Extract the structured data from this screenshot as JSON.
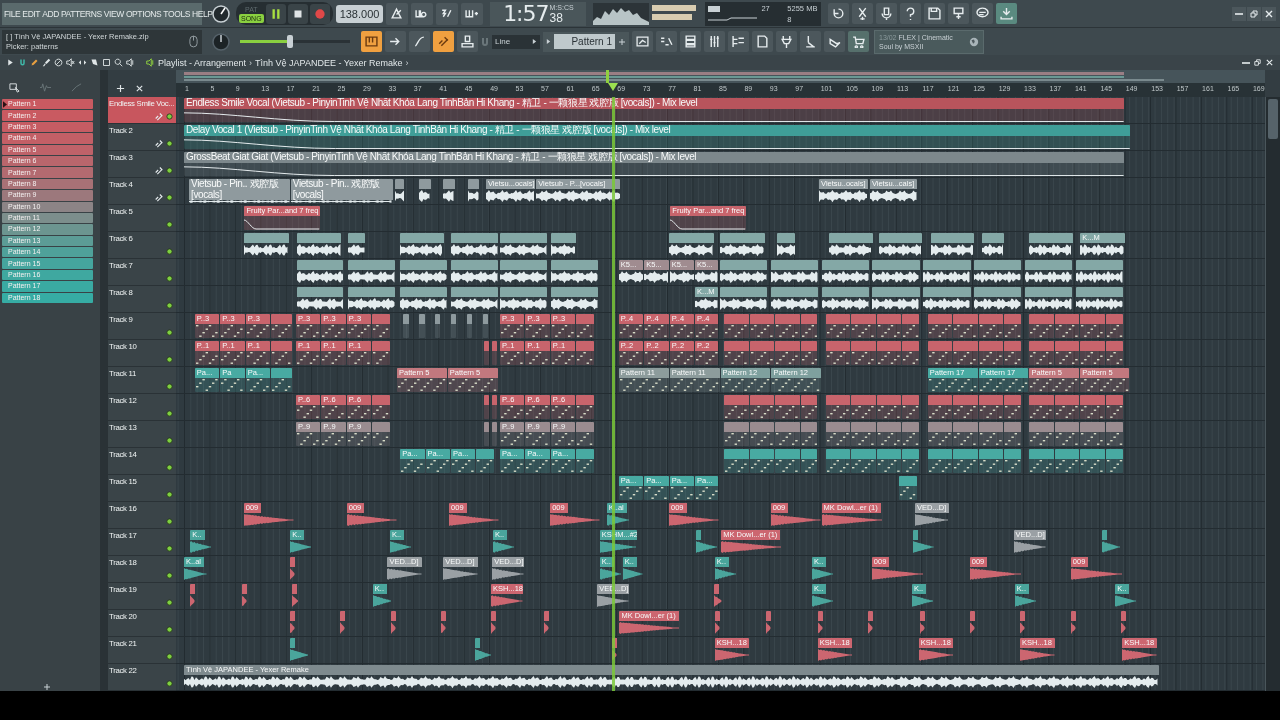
{
  "menu": [
    "FILE",
    "EDIT",
    "ADD",
    "PATTERNS",
    "VIEW",
    "OPTIONS",
    "TOOLS",
    "HELP"
  ],
  "mode": [
    {
      "label": "PAT",
      "selected": false
    },
    {
      "label": "SONG",
      "selected": true
    }
  ],
  "tempo": "138.000",
  "time": {
    "value": "1:57",
    "cs": "38",
    "unit": "M:S:CS"
  },
  "memory": {
    "cpu": "27",
    "ram": "5255 MB",
    "polyphony": "8"
  },
  "hint": {
    "line1": "[    ]  Tình Vệ JAPANDEE - Yexer Remake.zip",
    "line2": "Picker: patterns"
  },
  "master": {
    "level": 0.45
  },
  "snap": "Line",
  "pattern_selector": "Pattern 1",
  "news": {
    "date": "13/02",
    "title": "FLEX | Cinematic",
    "subtitle": "Soul by MSXII"
  },
  "playlist": {
    "title": "Playlist - Arrangement",
    "sep1": "›",
    "song": "Tình Vệ JAPANDEE - Yexer Remake",
    "sep2": "›"
  },
  "ruler": [
    "1",
    "5",
    "9",
    "13",
    "17",
    "21",
    "25",
    "29",
    "33",
    "37",
    "41",
    "45",
    "49",
    "53",
    "57",
    "61",
    "65",
    "69",
    "73",
    "77",
    "81",
    "85",
    "89",
    "93",
    "97",
    "101",
    "105",
    "109",
    "113",
    "117",
    "121",
    "125",
    "129",
    "133",
    "137",
    "141",
    "145",
    "149",
    "153",
    "157",
    "161",
    "165",
    "169"
  ],
  "patterns": [
    {
      "name": "Pattern 1",
      "color": "#c95a61",
      "selected": true
    },
    {
      "name": "Pattern 2",
      "color": "#c95a61",
      "selected": false
    },
    {
      "name": "Pattern 3",
      "color": "#c65c63",
      "selected": false
    },
    {
      "name": "Pattern 4",
      "color": "#c35f66",
      "selected": false
    },
    {
      "name": "Pattern 5",
      "color": "#bf6269",
      "selected": false
    },
    {
      "name": "Pattern 6",
      "color": "#b9666c",
      "selected": false
    },
    {
      "name": "Pattern 7",
      "color": "#b36a70",
      "selected": false
    },
    {
      "name": "Pattern 8",
      "color": "#a87176",
      "selected": false
    },
    {
      "name": "Pattern 9",
      "color": "#9c787c",
      "selected": false
    },
    {
      "name": "Pattern 10",
      "color": "#8c8486",
      "selected": false
    },
    {
      "name": "Pattern 11",
      "color": "#7c8e8c",
      "selected": false
    },
    {
      "name": "Pattern 12",
      "color": "#6c9590",
      "selected": false
    },
    {
      "name": "Pattern 13",
      "color": "#5c9c96",
      "selected": false
    },
    {
      "name": "Pattern 14",
      "color": "#4fa19a",
      "selected": false
    },
    {
      "name": "Pattern 15",
      "color": "#45a59e",
      "selected": false
    },
    {
      "name": "Pattern 16",
      "color": "#3fa8a0",
      "selected": false
    },
    {
      "name": "Pattern 17",
      "color": "#3aaaa2",
      "selected": false
    },
    {
      "name": "Pattern 18",
      "color": "#36aca4",
      "selected": false
    }
  ],
  "tracks": [
    {
      "name": "Endless Smile Voc...",
      "selected": true,
      "linked": true,
      "clips": [
        {
          "label": "Endless Smile Vocal (Vietsub - PinyinTinh Vệ  Nhất Khỏa Lang TinhBản Hi Khang - 精卫 - 一颗狼星 戏腔版 [vocals]) - Mix level",
          "kind": "automation",
          "color": "#b8545c"
        }
      ]
    },
    {
      "name": "Track 2",
      "selected": false,
      "linked": true,
      "clips": [
        {
          "label": "Delay Vocal 1 (Vietsub - PinyinTinh Vệ  Nhất Khỏa Lang TinhBản Hi Khang - 精卫 - 一颗狼星 戏腔版 [vocals]) - Mix level",
          "kind": "automation",
          "color": "#3f9e98"
        }
      ]
    },
    {
      "name": "Track 3",
      "selected": false,
      "linked": true,
      "clips": [
        {
          "label": "GrossBeat Giat Giat (Vietsub - PinyinTinh Vệ  Nhất Khỏa Lang TinhBản Hi Khang - 精卫 - 一颗狼星 戏腔版 [vocals]) - Mix level",
          "kind": "automation",
          "color": "#7d888c"
        }
      ]
    },
    {
      "name": "Track 4",
      "selected": false,
      "linked": true,
      "clips": [
        {
          "label": "Vietsub - Pin.. 戏腔版 [vocals]",
          "kind": "audio",
          "color": "#8f9a9e"
        },
        {
          "label": "Vietsub - Pin.. 戏腔版 [vocals]",
          "kind": "audio",
          "color": "#8f9a9e"
        },
        {
          "kind": "audio",
          "color": "#8f9a9e"
        },
        {
          "kind": "audio",
          "color": "#8f9a9e"
        },
        {
          "kind": "audio",
          "color": "#8f9a9e"
        },
        {
          "kind": "audio",
          "color": "#8f9a9e"
        },
        {
          "label": "Vietsu...ocals]",
          "kind": "audio",
          "color": "#8f9a9e"
        },
        {
          "label": "Vietsub - P...[vocals]",
          "kind": "audio",
          "color": "#8f9a9e"
        },
        {
          "label": "Vietsu..ocals]",
          "kind": "audio",
          "color": "#8f9a9e"
        },
        {
          "label": "Vietsu...cals]",
          "kind": "audio",
          "color": "#8f9a9e"
        }
      ]
    },
    {
      "name": "Track 5",
      "selected": false,
      "linked": false,
      "clips": [
        {
          "label": "Fruity Par...and 7 freq",
          "kind": "automation",
          "color": "#c8646c"
        },
        {
          "label": "Fruity Par...and 7 freq",
          "kind": "automation",
          "color": "#c8646c"
        }
      ]
    },
    {
      "name": "Track 6",
      "selected": false,
      "linked": false,
      "clips": [
        {
          "kind": "audio",
          "color": "#84a8a6"
        },
        {
          "kind": "audio",
          "color": "#84a8a6"
        },
        {
          "kind": "audio",
          "color": "#84a8a6"
        },
        {
          "kind": "audio",
          "color": "#84a8a6"
        },
        {
          "kind": "audio",
          "color": "#84a8a6"
        },
        {
          "kind": "audio",
          "color": "#84a8a6"
        },
        {
          "kind": "audio",
          "color": "#84a8a6"
        },
        {
          "kind": "audio",
          "color": "#84a8a6"
        },
        {
          "kind": "audio",
          "color": "#84a8a6"
        },
        {
          "kind": "audio",
          "color": "#84a8a6"
        },
        {
          "kind": "audio",
          "color": "#84a8a6"
        },
        {
          "kind": "audio",
          "color": "#84a8a6"
        },
        {
          "kind": "audio",
          "color": "#84a8a6"
        },
        {
          "kind": "audio",
          "color": "#84a8a6"
        },
        {
          "kind": "audio",
          "color": "#84a8a6"
        },
        {
          "label": "K...M",
          "kind": "audio",
          "color": "#84a8a6"
        }
      ]
    },
    {
      "name": "Track 7",
      "selected": false,
      "linked": false,
      "clips": [
        {
          "kind": "audio",
          "color": "#84a8a6"
        },
        {
          "kind": "audio",
          "color": "#84a8a6"
        },
        {
          "kind": "audio",
          "color": "#84a8a6"
        },
        {
          "kind": "audio",
          "color": "#84a8a6"
        },
        {
          "kind": "audio",
          "color": "#84a8a6"
        },
        {
          "kind": "audio",
          "color": "#84a8a6"
        },
        {
          "label": "K5...",
          "kind": "audio",
          "color": "#a08c90"
        },
        {
          "label": "K5...",
          "kind": "audio",
          "color": "#a08c90"
        },
        {
          "label": "K5...",
          "kind": "audio",
          "color": "#a08c90"
        },
        {
          "label": "K5...",
          "kind": "audio",
          "color": "#a08c90"
        },
        {
          "kind": "audio",
          "color": "#84a8a6"
        },
        {
          "kind": "audio",
          "color": "#84a8a6"
        },
        {
          "kind": "audio",
          "color": "#84a8a6"
        },
        {
          "kind": "audio",
          "color": "#84a8a6"
        },
        {
          "kind": "audio",
          "color": "#84a8a6"
        },
        {
          "kind": "audio",
          "color": "#84a8a6"
        },
        {
          "kind": "audio",
          "color": "#84a8a6"
        },
        {
          "kind": "audio",
          "color": "#84a8a6"
        }
      ]
    },
    {
      "name": "Track 8",
      "selected": false,
      "linked": false,
      "clips": [
        {
          "kind": "audio",
          "color": "#84a8a6"
        },
        {
          "kind": "audio",
          "color": "#84a8a6"
        },
        {
          "kind": "audio",
          "color": "#84a8a6"
        },
        {
          "kind": "audio",
          "color": "#84a8a6"
        },
        {
          "kind": "audio",
          "color": "#84a8a6"
        },
        {
          "kind": "audio",
          "color": "#84a8a6"
        },
        {
          "label": "K...M",
          "kind": "audio",
          "color": "#84a8a6"
        },
        {
          "kind": "audio",
          "color": "#84a8a6"
        },
        {
          "kind": "audio",
          "color": "#84a8a6"
        },
        {
          "kind": "audio",
          "color": "#84a8a6"
        },
        {
          "kind": "audio",
          "color": "#84a8a6"
        },
        {
          "kind": "audio",
          "color": "#84a8a6"
        },
        {
          "kind": "audio",
          "color": "#84a8a6"
        },
        {
          "kind": "audio",
          "color": "#84a8a6"
        },
        {
          "kind": "audio",
          "color": "#84a8a6"
        }
      ]
    },
    {
      "name": "Track 9",
      "selected": false,
      "linked": false,
      "clips": [
        {
          "label": "P..3",
          "kind": "pattern",
          "color": "#c8646c"
        },
        {
          "label": "P..3",
          "kind": "pattern",
          "color": "#c8646c"
        },
        {
          "label": "P..3",
          "kind": "pattern",
          "color": "#c8646c"
        },
        {
          "kind": "pattern",
          "color": "#c8646c"
        },
        {
          "label": "P..3",
          "kind": "pattern",
          "color": "#c8646c"
        },
        {
          "label": "P..3",
          "kind": "pattern",
          "color": "#c8646c"
        },
        {
          "label": "P..3",
          "kind": "pattern",
          "color": "#c8646c"
        },
        {
          "kind": "pattern",
          "color": "#c8646c"
        },
        {
          "kind": "pattern",
          "color": "#8e9a9e"
        },
        {
          "kind": "pattern",
          "color": "#8e9a9e"
        },
        {
          "kind": "pattern",
          "color": "#8e9a9e"
        },
        {
          "kind": "pattern",
          "color": "#8e9a9e"
        },
        {
          "kind": "pattern",
          "color": "#8e9a9e"
        },
        {
          "kind": "pattern",
          "color": "#8e9a9e"
        },
        {
          "label": "P..3",
          "kind": "pattern",
          "color": "#c8646c"
        },
        {
          "label": "P..3",
          "kind": "pattern",
          "color": "#c8646c"
        },
        {
          "label": "P..3",
          "kind": "pattern",
          "color": "#c8646c"
        },
        {
          "kind": "pattern",
          "color": "#c8646c"
        },
        {
          "label": "P..4",
          "kind": "pattern",
          "color": "#c8646c"
        },
        {
          "label": "P..4",
          "kind": "pattern",
          "color": "#c8646c"
        },
        {
          "label": "P..4",
          "kind": "pattern",
          "color": "#c8646c"
        },
        {
          "label": "P..4",
          "kind": "pattern",
          "color": "#c8646c"
        },
        {
          "kind": "pattern",
          "color": "#c8646c"
        },
        {
          "kind": "pattern",
          "color": "#c8646c"
        },
        {
          "kind": "pattern",
          "color": "#c8646c"
        },
        {
          "kind": "pattern",
          "color": "#c8646c"
        },
        {
          "kind": "pattern",
          "color": "#c8646c"
        },
        {
          "kind": "pattern",
          "color": "#c8646c"
        },
        {
          "kind": "pattern",
          "color": "#c8646c"
        },
        {
          "kind": "pattern",
          "color": "#c8646c"
        },
        {
          "kind": "pattern",
          "color": "#c8646c"
        },
        {
          "kind": "pattern",
          "color": "#c8646c"
        },
        {
          "kind": "pattern",
          "color": "#c8646c"
        },
        {
          "kind": "pattern",
          "color": "#c8646c"
        },
        {
          "kind": "pattern",
          "color": "#c8646c"
        },
        {
          "kind": "pattern",
          "color": "#c8646c"
        },
        {
          "kind": "pattern",
          "color": "#c8646c"
        },
        {
          "kind": "pattern",
          "color": "#c8646c"
        }
      ]
    },
    {
      "name": "Track 10",
      "selected": false,
      "linked": false,
      "clips": [
        {
          "label": "P..1",
          "kind": "pattern",
          "color": "#c8646c"
        },
        {
          "label": "P..1",
          "kind": "pattern",
          "color": "#c8646c"
        },
        {
          "label": "P..1",
          "kind": "pattern",
          "color": "#c8646c"
        },
        {
          "kind": "pattern",
          "color": "#c8646c"
        },
        {
          "label": "P..1",
          "kind": "pattern",
          "color": "#c8646c"
        },
        {
          "label": "P..1",
          "kind": "pattern",
          "color": "#c8646c"
        },
        {
          "label": "P..1",
          "kind": "pattern",
          "color": "#c8646c"
        },
        {
          "kind": "pattern",
          "color": "#c8646c"
        },
        {
          "kind": "pattern",
          "color": "#c8646c"
        },
        {
          "kind": "pattern",
          "color": "#c8646c"
        },
        {
          "label": "P..1",
          "kind": "pattern",
          "color": "#c8646c"
        },
        {
          "label": "P..1",
          "kind": "pattern",
          "color": "#c8646c"
        },
        {
          "label": "P..1",
          "kind": "pattern",
          "color": "#c8646c"
        },
        {
          "kind": "pattern",
          "color": "#c8646c"
        },
        {
          "label": "P..2",
          "kind": "pattern",
          "color": "#c8646c"
        },
        {
          "label": "P..2",
          "kind": "pattern",
          "color": "#c8646c"
        },
        {
          "label": "P..2",
          "kind": "pattern",
          "color": "#c8646c"
        },
        {
          "label": "P..2",
          "kind": "pattern",
          "color": "#c8646c"
        },
        {
          "kind": "pattern",
          "color": "#c8646c"
        },
        {
          "kind": "pattern",
          "color": "#c8646c"
        },
        {
          "kind": "pattern",
          "color": "#c8646c"
        },
        {
          "kind": "pattern",
          "color": "#c8646c"
        },
        {
          "kind": "pattern",
          "color": "#c8646c"
        },
        {
          "kind": "pattern",
          "color": "#c8646c"
        },
        {
          "kind": "pattern",
          "color": "#c8646c"
        },
        {
          "kind": "pattern",
          "color": "#c8646c"
        },
        {
          "kind": "pattern",
          "color": "#c8646c"
        },
        {
          "kind": "pattern",
          "color": "#c8646c"
        },
        {
          "kind": "pattern",
          "color": "#c8646c"
        },
        {
          "kind": "pattern",
          "color": "#c8646c"
        },
        {
          "kind": "pattern",
          "color": "#c8646c"
        },
        {
          "kind": "pattern",
          "color": "#c8646c"
        },
        {
          "kind": "pattern",
          "color": "#c8646c"
        },
        {
          "kind": "pattern",
          "color": "#c8646c"
        }
      ]
    },
    {
      "name": "Track 11",
      "selected": false,
      "linked": false,
      "clips": [
        {
          "label": "Pa...",
          "kind": "pattern",
          "color": "#48aaa2"
        },
        {
          "label": "Pa",
          "kind": "pattern",
          "color": "#48aaa2"
        },
        {
          "label": "Pa...",
          "kind": "pattern",
          "color": "#48aaa2"
        },
        {
          "kind": "pattern",
          "color": "#48aaa2"
        },
        {
          "label": "Pattern 5",
          "kind": "pattern",
          "color": "#c2787e"
        },
        {
          "label": "Pattern 5",
          "kind": "pattern",
          "color": "#c2787e"
        },
        {
          "label": "Pattern 11",
          "kind": "pattern",
          "color": "#8d9c9c"
        },
        {
          "label": "Pattern 11",
          "kind": "pattern",
          "color": "#8d9c9c"
        },
        {
          "label": "Pattern 12",
          "kind": "pattern",
          "color": "#7fa09e"
        },
        {
          "label": "Pattern 12",
          "kind": "pattern",
          "color": "#7fa09e"
        },
        {
          "label": "Pattern 17",
          "kind": "pattern",
          "color": "#48aaa2"
        },
        {
          "label": "Pattern 17",
          "kind": "pattern",
          "color": "#48aaa2"
        },
        {
          "label": "Pattern 5",
          "kind": "pattern",
          "color": "#c2787e"
        },
        {
          "label": "Pattern 5",
          "kind": "pattern",
          "color": "#c2787e"
        }
      ]
    },
    {
      "name": "Track 12",
      "selected": false,
      "linked": false,
      "clips": [
        {
          "label": "P..6",
          "kind": "pattern",
          "color": "#c8646c"
        },
        {
          "label": "P..6",
          "kind": "pattern",
          "color": "#c8646c"
        },
        {
          "label": "P..6",
          "kind": "pattern",
          "color": "#c8646c"
        },
        {
          "kind": "pattern",
          "color": "#c8646c"
        },
        {
          "kind": "pattern",
          "color": "#c8646c"
        },
        {
          "kind": "pattern",
          "color": "#c8646c"
        },
        {
          "label": "P..6",
          "kind": "pattern",
          "color": "#c8646c"
        },
        {
          "label": "P..6",
          "kind": "pattern",
          "color": "#c8646c"
        },
        {
          "label": "P..6",
          "kind": "pattern",
          "color": "#c8646c"
        },
        {
          "kind": "pattern",
          "color": "#c8646c"
        },
        {
          "kind": "pattern",
          "color": "#c8646c"
        },
        {
          "kind": "pattern",
          "color": "#c8646c"
        },
        {
          "kind": "pattern",
          "color": "#c8646c"
        },
        {
          "kind": "pattern",
          "color": "#c8646c"
        },
        {
          "kind": "pattern",
          "color": "#c8646c"
        },
        {
          "kind": "pattern",
          "color": "#c8646c"
        },
        {
          "kind": "pattern",
          "color": "#c8646c"
        },
        {
          "kind": "pattern",
          "color": "#c8646c"
        },
        {
          "kind": "pattern",
          "color": "#c8646c"
        },
        {
          "kind": "pattern",
          "color": "#c8646c"
        },
        {
          "kind": "pattern",
          "color": "#c8646c"
        },
        {
          "kind": "pattern",
          "color": "#c8646c"
        },
        {
          "kind": "pattern",
          "color": "#c8646c"
        },
        {
          "kind": "pattern",
          "color": "#c8646c"
        },
        {
          "kind": "pattern",
          "color": "#c8646c"
        },
        {
          "kind": "pattern",
          "color": "#c8646c"
        }
      ]
    },
    {
      "name": "Track 13",
      "selected": false,
      "linked": false,
      "clips": [
        {
          "label": "P..9",
          "kind": "pattern",
          "color": "#9a8c90"
        },
        {
          "label": "P..9",
          "kind": "pattern",
          "color": "#9a8c90"
        },
        {
          "label": "P..9",
          "kind": "pattern",
          "color": "#9a8c90"
        },
        {
          "kind": "pattern",
          "color": "#9a8c90"
        },
        {
          "kind": "pattern",
          "color": "#9a8c90"
        },
        {
          "kind": "pattern",
          "color": "#9a8c90"
        },
        {
          "label": "P..9",
          "kind": "pattern",
          "color": "#9a8c90"
        },
        {
          "label": "P..9",
          "kind": "pattern",
          "color": "#9a8c90"
        },
        {
          "label": "P..9",
          "kind": "pattern",
          "color": "#9a8c90"
        },
        {
          "kind": "pattern",
          "color": "#9a8c90"
        },
        {
          "kind": "pattern",
          "color": "#9a8c90"
        },
        {
          "kind": "pattern",
          "color": "#9a8c90"
        },
        {
          "kind": "pattern",
          "color": "#9a8c90"
        },
        {
          "kind": "pattern",
          "color": "#9a8c90"
        },
        {
          "kind": "pattern",
          "color": "#9a8c90"
        },
        {
          "kind": "pattern",
          "color": "#9a8c90"
        },
        {
          "kind": "pattern",
          "color": "#9a8c90"
        },
        {
          "kind": "pattern",
          "color": "#9a8c90"
        },
        {
          "kind": "pattern",
          "color": "#9a8c90"
        },
        {
          "kind": "pattern",
          "color": "#9a8c90"
        },
        {
          "kind": "pattern",
          "color": "#9a8c90"
        },
        {
          "kind": "pattern",
          "color": "#9a8c90"
        },
        {
          "kind": "pattern",
          "color": "#9a8c90"
        },
        {
          "kind": "pattern",
          "color": "#9a8c90"
        },
        {
          "kind": "pattern",
          "color": "#9a8c90"
        },
        {
          "kind": "pattern",
          "color": "#9a8c90"
        }
      ]
    },
    {
      "name": "Track 14",
      "selected": false,
      "linked": false,
      "clips": [
        {
          "label": "Pa...",
          "kind": "pattern",
          "color": "#48aaa2"
        },
        {
          "label": "Pa...",
          "kind": "pattern",
          "color": "#48aaa2"
        },
        {
          "label": "Pa...",
          "kind": "pattern",
          "color": "#48aaa2"
        },
        {
          "kind": "pattern",
          "color": "#48aaa2"
        },
        {
          "label": "Pa...",
          "kind": "pattern",
          "color": "#48aaa2"
        },
        {
          "label": "Pa...",
          "kind": "pattern",
          "color": "#48aaa2"
        },
        {
          "label": "Pa...",
          "kind": "pattern",
          "color": "#48aaa2"
        },
        {
          "kind": "pattern",
          "color": "#48aaa2"
        },
        {
          "kind": "pattern",
          "color": "#48aaa2"
        },
        {
          "kind": "pattern",
          "color": "#48aaa2"
        },
        {
          "kind": "pattern",
          "color": "#48aaa2"
        },
        {
          "kind": "pattern",
          "color": "#48aaa2"
        },
        {
          "kind": "pattern",
          "color": "#48aaa2"
        },
        {
          "kind": "pattern",
          "color": "#48aaa2"
        },
        {
          "kind": "pattern",
          "color": "#48aaa2"
        },
        {
          "kind": "pattern",
          "color": "#48aaa2"
        },
        {
          "kind": "pattern",
          "color": "#48aaa2"
        },
        {
          "kind": "pattern",
          "color": "#48aaa2"
        },
        {
          "kind": "pattern",
          "color": "#48aaa2"
        },
        {
          "kind": "pattern",
          "color": "#48aaa2"
        },
        {
          "kind": "pattern",
          "color": "#48aaa2"
        },
        {
          "kind": "pattern",
          "color": "#48aaa2"
        },
        {
          "kind": "pattern",
          "color": "#48aaa2"
        },
        {
          "kind": "pattern",
          "color": "#48aaa2"
        }
      ]
    },
    {
      "name": "Track 15",
      "selected": false,
      "linked": false,
      "clips": [
        {
          "label": "Pa...",
          "kind": "pattern",
          "color": "#48aaa2"
        },
        {
          "label": "Pa...",
          "kind": "pattern",
          "color": "#48aaa2"
        },
        {
          "label": "Pa...",
          "kind": "pattern",
          "color": "#48aaa2"
        },
        {
          "label": "Pa...",
          "kind": "pattern",
          "color": "#48aaa2"
        },
        {
          "kind": "pattern",
          "color": "#48aaa2"
        }
      ]
    },
    {
      "name": "Track 16",
      "selected": false,
      "linked": false,
      "clips": [
        {
          "label": "009",
          "kind": "audio",
          "color": "#cc6670"
        },
        {
          "label": "009",
          "kind": "audio",
          "color": "#cc6670"
        },
        {
          "label": "009",
          "kind": "audio",
          "color": "#cc6670"
        },
        {
          "label": "009",
          "kind": "audio",
          "color": "#cc6670"
        },
        {
          "label": "K..al",
          "kind": "audio",
          "color": "#4aa59c"
        },
        {
          "label": "009",
          "kind": "audio",
          "color": "#cc6670"
        },
        {
          "label": "009",
          "kind": "audio",
          "color": "#cc6670"
        },
        {
          "label": "MK Dowl...er (1)",
          "kind": "audio",
          "color": "#cc6670"
        },
        {
          "label": "VED...D]",
          "kind": "audio",
          "color": "#9aa0a4"
        }
      ]
    },
    {
      "name": "Track 17",
      "selected": false,
      "linked": false,
      "clips": [
        {
          "label": "K..",
          "kind": "audio",
          "color": "#4aa59c"
        },
        {
          "label": "K..",
          "kind": "audio",
          "color": "#4aa59c"
        },
        {
          "label": "K..",
          "kind": "audio",
          "color": "#4aa59c"
        },
        {
          "label": "K..",
          "kind": "audio",
          "color": "#4aa59c"
        },
        {
          "label": "KSHM...#2",
          "kind": "audio",
          "color": "#4aa59c"
        },
        {
          "kind": "audio",
          "color": "#4aa59c"
        },
        {
          "label": "MK Dowl...er (1)",
          "kind": "audio",
          "color": "#cc6670"
        },
        {
          "kind": "audio",
          "color": "#4aa59c"
        },
        {
          "label": "VED...D]",
          "kind": "audio",
          "color": "#9aa0a4"
        },
        {
          "kind": "audio",
          "color": "#4aa59c"
        }
      ]
    },
    {
      "name": "Track 18",
      "selected": false,
      "linked": false,
      "clips": [
        {
          "label": "K..al",
          "kind": "audio",
          "color": "#4aa59c"
        },
        {
          "kind": "audio",
          "color": "#cc6670"
        },
        {
          "label": "VED...D]",
          "kind": "audio",
          "color": "#9aa0a4"
        },
        {
          "label": "VED...D]",
          "kind": "audio",
          "color": "#9aa0a4"
        },
        {
          "label": "VED...D]",
          "kind": "audio",
          "color": "#9aa0a4"
        },
        {
          "label": "K..",
          "kind": "audio",
          "color": "#4aa59c"
        },
        {
          "label": "K..",
          "kind": "audio",
          "color": "#4aa59c"
        },
        {
          "label": "K..",
          "kind": "audio",
          "color": "#4aa59c"
        },
        {
          "label": "K..",
          "kind": "audio",
          "color": "#4aa59c"
        },
        {
          "label": "009",
          "kind": "audio",
          "color": "#cc6670"
        },
        {
          "label": "009",
          "kind": "audio",
          "color": "#cc6670"
        },
        {
          "label": "009",
          "kind": "audio",
          "color": "#cc6670"
        }
      ]
    },
    {
      "name": "Track 19",
      "selected": false,
      "linked": false,
      "clips": [
        {
          "kind": "audio",
          "color": "#cc6670"
        },
        {
          "kind": "audio",
          "color": "#cc6670"
        },
        {
          "kind": "audio",
          "color": "#cc6670"
        },
        {
          "label": "K..",
          "kind": "audio",
          "color": "#4aa59c"
        },
        {
          "label": "KSH...18",
          "kind": "audio",
          "color": "#cc6670"
        },
        {
          "label": "VED...D]",
          "kind": "audio",
          "color": "#9aa0a4"
        },
        {
          "kind": "audio",
          "color": "#cc6670"
        },
        {
          "label": "K..",
          "kind": "audio",
          "color": "#4aa59c"
        },
        {
          "label": "K..",
          "kind": "audio",
          "color": "#4aa59c"
        },
        {
          "label": "K..",
          "kind": "audio",
          "color": "#4aa59c"
        },
        {
          "label": "K..",
          "kind": "audio",
          "color": "#4aa59c"
        }
      ]
    },
    {
      "name": "Track 20",
      "selected": false,
      "linked": false,
      "clips": [
        {
          "kind": "audio",
          "color": "#cc6670"
        },
        {
          "kind": "audio",
          "color": "#cc6670"
        },
        {
          "kind": "audio",
          "color": "#cc6670"
        },
        {
          "kind": "audio",
          "color": "#cc6670"
        },
        {
          "kind": "audio",
          "color": "#cc6670"
        },
        {
          "kind": "audio",
          "color": "#cc6670"
        },
        {
          "label": "MK Dowl...er (1)",
          "kind": "audio",
          "color": "#cc6670"
        },
        {
          "kind": "audio",
          "color": "#cc6670"
        },
        {
          "kind": "audio",
          "color": "#cc6670"
        },
        {
          "kind": "audio",
          "color": "#cc6670"
        },
        {
          "kind": "audio",
          "color": "#cc6670"
        },
        {
          "kind": "audio",
          "color": "#cc6670"
        },
        {
          "kind": "audio",
          "color": "#cc6670"
        },
        {
          "kind": "audio",
          "color": "#cc6670"
        },
        {
          "kind": "audio",
          "color": "#cc6670"
        },
        {
          "kind": "audio",
          "color": "#cc6670"
        }
      ]
    },
    {
      "name": "Track 21",
      "selected": false,
      "linked": false,
      "clips": [
        {
          "kind": "audio",
          "color": "#4aa59c"
        },
        {
          "kind": "audio",
          "color": "#4aa59c"
        },
        {
          "kind": "audio",
          "color": "#cc6670"
        },
        {
          "label": "KSH...18",
          "kind": "audio",
          "color": "#cc6670"
        },
        {
          "label": "KSH...18",
          "kind": "audio",
          "color": "#cc6670"
        },
        {
          "label": "KSH...18",
          "kind": "audio",
          "color": "#cc6670"
        },
        {
          "label": "KSH...18",
          "kind": "audio",
          "color": "#cc6670"
        },
        {
          "label": "KSH...18",
          "kind": "audio",
          "color": "#cc6670"
        }
      ]
    },
    {
      "name": "Track 22",
      "selected": false,
      "linked": false,
      "clips": [
        {
          "label": "Tình Vệ JAPANDEE - Yexer Remake",
          "kind": "audio",
          "color": "#7e8a8e"
        }
      ]
    }
  ]
}
